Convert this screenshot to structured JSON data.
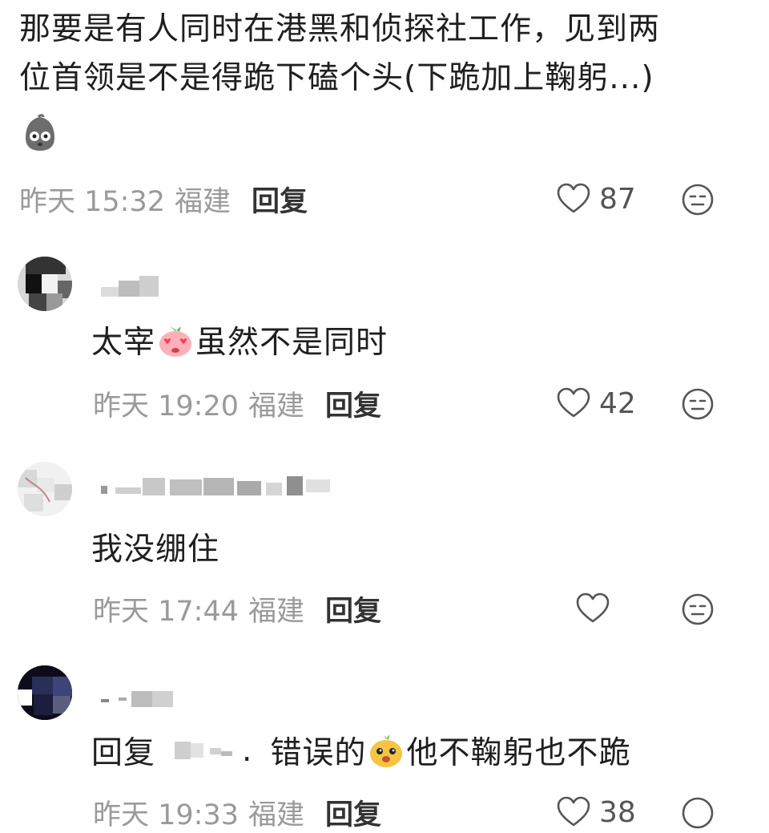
{
  "post": {
    "line1": "那要是有人同时在港黑和侦探社工作，见到两",
    "line2": "位首领是不是得跪下磕个头(下跪加上鞠躬...)",
    "time": "昨天 15:32",
    "location": "福建",
    "reply_label": "回复",
    "likes": "87"
  },
  "comments": [
    {
      "text_before": "太宰",
      "text_after": "虽然不是同时",
      "time": "昨天 19:20",
      "location": "福建",
      "reply_label": "回复",
      "likes": "42"
    },
    {
      "text": "我没绷住",
      "time": "昨天 17:44",
      "location": "福建",
      "reply_label": "回复",
      "likes": ""
    },
    {
      "reply_prefix": "回复",
      "reply_target_suffix": ".",
      "text_before": "错误的",
      "text_after": "他不鞠躬也不跪",
      "time": "昨天 19:33",
      "location": "福建",
      "reply_label": "回复",
      "likes": "38"
    }
  ],
  "icons": {
    "like": "heart-outline-icon",
    "react": "neutral-face-icon",
    "post_sticker": "ghost-face-sticker",
    "comment1_emoji": "strawberry-love-eyes-emoji",
    "comment3_emoji": "puppy-face-emoji"
  },
  "colors": {
    "meta_text": "#9a9a9a",
    "body_text": "#1f1f1f",
    "icon_stroke": "#555555"
  }
}
